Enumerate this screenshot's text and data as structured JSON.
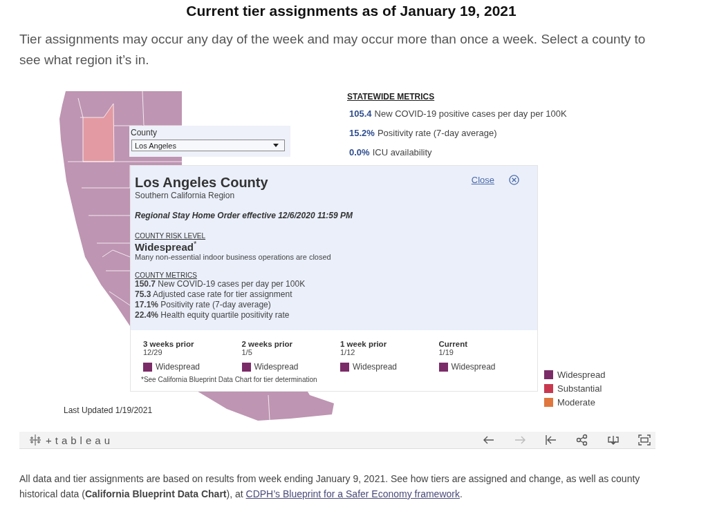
{
  "heading": "Current tier assignments as of January 19, 2021",
  "intro": "Tier assignments may occur any day of the week and may occur more than once a week. Select a county to see what region it’s in.",
  "dashboard": {
    "county_filter": {
      "label": "County",
      "value": "Los Angeles"
    },
    "statewide_metrics": {
      "title": "STATEWIDE METRICS",
      "items": [
        {
          "value": "105.4",
          "label": "New COVID-19 positive cases per day per 100K"
        },
        {
          "value": "15.2%",
          "label": "Positivity rate (7-day average)"
        },
        {
          "value": "0.0%",
          "label": "ICU availability"
        }
      ]
    },
    "county_popup": {
      "title": "Los Angeles County",
      "region": "Southern California Region",
      "close": "Close",
      "order": "Regional Stay Home Order effective 12/6/2020 11:59 PM",
      "risk_heading": "COUNTY RISK LEVEL",
      "risk_level": "Widespread",
      "risk_mark": "*",
      "risk_note": "Many non-essential indoor business operations are closed",
      "metrics_heading": "COUNTY METRICS",
      "metrics": [
        "**150.7** New COVID-19 cases per day per 100K",
        "**75.3** Adjusted case rate for tier assignment",
        "**17.1%** Positivity rate (7-day average)",
        "**22.4%** Health equity quartile positivity rate"
      ],
      "history": [
        {
          "period": "3 weeks prior",
          "date": "12/29",
          "tier": "Widespread",
          "color": "#7b2c68"
        },
        {
          "period": "2 weeks prior",
          "date": "1/5",
          "tier": "Widespread",
          "color": "#7b2c68"
        },
        {
          "period": "1 week prior",
          "date": "1/12",
          "tier": "Widespread",
          "color": "#7b2c68"
        },
        {
          "period": "Current",
          "date": "1/19",
          "tier": "Widespread",
          "color": "#7b2c68"
        }
      ],
      "footnote": "*See California Blueprint Data Chart for tier determination"
    },
    "last_updated": "Last Updated 1/19/2021",
    "legend": [
      {
        "label": "Widespread",
        "color": "#7b2c68"
      },
      {
        "label": "Substantial",
        "color": "#c8394f"
      },
      {
        "label": "Moderate",
        "color": "#e0773f"
      }
    ]
  },
  "toolbar": {
    "logo": "+tableau",
    "buttons": [
      {
        "kind": "undo",
        "disabled": false
      },
      {
        "kind": "redo",
        "disabled": true
      },
      {
        "kind": "revert",
        "disabled": false
      },
      {
        "kind": "share",
        "disabled": false
      },
      {
        "kind": "download",
        "disabled": false
      },
      {
        "kind": "fullscreen",
        "disabled": false
      }
    ]
  },
  "footer": {
    "before": "All data and tier assignments are based on results from week ending January 9, 2021. See how tiers are assigned and change, as well as county historical data (**California Blueprint Data Chart**), at ",
    "link": "CDPH’s Blueprint for a Safer Economy framework",
    "after": "."
  }
}
